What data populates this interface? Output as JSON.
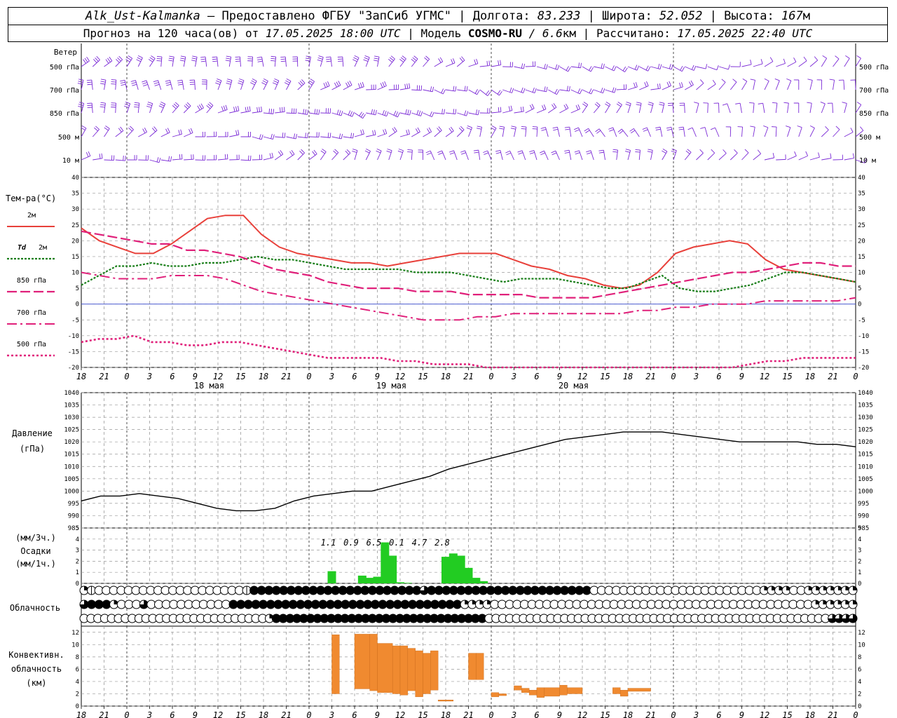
{
  "header": {
    "station": "Alk_Ust-Kalmanka",
    "provider": "– Предоставлено ФГБУ \"ЗапСиб УГМС\"",
    "lon_label": "| Долгота:",
    "lon_value": "83.233",
    "lat_label": "| Широта:",
    "lat_value": "52.052",
    "alt_label": "| Высота:",
    "alt_value": "167",
    "alt_unit": "м",
    "fc_label": "Прогноз на 120 часа(ов) от",
    "fc_date": "17.05.2025 18:00 UTC",
    "model_label": "| Модель",
    "model_name": "COSMO-RU",
    "model_res": "/ 6.6",
    "model_res_unit": "км",
    "calc_label": "| Рассчитано:",
    "calc_date": "17.05.2025 22:40 UTC"
  },
  "colors": {
    "wind": "#7b2ad6",
    "t2m": "#e8403a",
    "td2m": "#1a7f1a",
    "p850": "#e0207a",
    "p700": "#e0207a",
    "p500": "#e0207a",
    "zero": "#3344cc",
    "pressure": "#000000",
    "precip": "#22cc22",
    "conv": "#f08a30",
    "grid": "#999999"
  },
  "panels": {
    "wind": {
      "title": "Ветер",
      "levels": [
        "500 гПа",
        "700 гПа",
        "850 гПа",
        "500 м",
        "10 м"
      ]
    },
    "temp": {
      "title": "Тем-ра(°C)",
      "legend": [
        {
          "key": "t2m",
          "label": "2м"
        },
        {
          "key": "td2m",
          "label": "Td",
          "label2": "2м"
        },
        {
          "key": "p850",
          "label": "850 гПа"
        },
        {
          "key": "p700",
          "label": "700 гПа"
        },
        {
          "key": "p500",
          "label": "500 гПа"
        }
      ]
    },
    "pressure": {
      "title": "Давление",
      "unit": "(гПа)"
    },
    "precip": {
      "unit_top": "(мм/3ч.)",
      "title": "Осадки",
      "unit_bottom": "(мм/1ч.)"
    },
    "cloud": {
      "title": "Облачность"
    },
    "conv": {
      "title1": "Конвективн.",
      "title2": "облачность",
      "unit": "(км)"
    }
  },
  "time_axis": {
    "hour_ticks": [
      "18",
      "21",
      "0",
      "3",
      "6",
      "9",
      "12",
      "15",
      "18",
      "21",
      "0",
      "3",
      "6",
      "9",
      "12",
      "15",
      "18",
      "21",
      "0",
      "3",
      "6",
      "9",
      "12",
      "15",
      "18",
      "21",
      "0",
      "3",
      "6",
      "9",
      "12",
      "15",
      "18",
      "21",
      "0"
    ],
    "day_labels": [
      "18 мая",
      "19 мая",
      "20 мая"
    ]
  },
  "chart_data": {
    "type": "line",
    "x_hours": [
      0,
      3,
      6,
      9,
      12,
      15,
      18,
      21,
      24,
      27,
      30,
      33,
      36,
      39,
      42,
      45,
      48,
      51,
      54,
      57,
      60,
      63,
      66,
      69,
      72,
      75,
      78,
      81,
      84,
      87,
      90,
      93,
      96,
      99,
      102
    ],
    "temperature": {
      "ylim": [
        -20,
        40
      ],
      "yticks": [
        -20,
        -15,
        -10,
        -5,
        0,
        5,
        10,
        15,
        20,
        25,
        30,
        35,
        40
      ],
      "series": [
        {
          "key": "t2m",
          "name": "2м",
          "values": [
            24,
            20,
            18,
            16,
            16,
            19,
            23,
            27,
            28,
            28,
            22,
            18,
            16,
            15,
            14,
            13,
            13,
            12,
            13,
            14,
            15,
            16,
            16,
            16,
            14,
            12,
            11,
            9,
            8,
            6,
            5,
            6,
            10,
            16,
            18,
            19,
            20,
            19,
            14,
            11,
            10,
            9,
            8,
            7
          ]
        },
        {
          "key": "td2m",
          "name": "Td 2м",
          "values": [
            6,
            9,
            12,
            12,
            13,
            12,
            12,
            13,
            13,
            14,
            15,
            14,
            14,
            13,
            12,
            11,
            11,
            11,
            11,
            10,
            10,
            10,
            9,
            8,
            7,
            8,
            8,
            8,
            7,
            6,
            5,
            5,
            7,
            9,
            5,
            4,
            4,
            5,
            6,
            8,
            10,
            10,
            9,
            8,
            7
          ]
        },
        {
          "key": "p850",
          "name": "850 гПа",
          "values": [
            23,
            22,
            21,
            20,
            19,
            19,
            17,
            17,
            16,
            15,
            13,
            11,
            10,
            9,
            7,
            6,
            5,
            5,
            5,
            4,
            4,
            4,
            3,
            3,
            3,
            3,
            2,
            2,
            2,
            2,
            3,
            4,
            5,
            6,
            7,
            8,
            9,
            10,
            10,
            11,
            12,
            13,
            13,
            12,
            12
          ]
        },
        {
          "key": "p700",
          "name": "700 гПа",
          "values": [
            10,
            9,
            8,
            8,
            8,
            9,
            9,
            9,
            8,
            6,
            4,
            3,
            2,
            1,
            0,
            -1,
            -2,
            -3,
            -4,
            -5,
            -5,
            -5,
            -4,
            -4,
            -3,
            -3,
            -3,
            -3,
            -3,
            -3,
            -3,
            -2,
            -2,
            -1,
            -1,
            0,
            0,
            0,
            1,
            1,
            1,
            1,
            1,
            2
          ]
        },
        {
          "key": "p500",
          "name": "500 гПа",
          "values": [
            -12,
            -11,
            -11,
            -10,
            -12,
            -12,
            -13,
            -13,
            -12,
            -12,
            -13,
            -14,
            -15,
            -16,
            -17,
            -17,
            -17,
            -17,
            -18,
            -18,
            -19,
            -19,
            -19,
            -20,
            -20,
            -20,
            -20,
            -20,
            -20,
            -20,
            -20,
            -20,
            -20,
            -20,
            -20,
            -20,
            -20,
            -20,
            -19,
            -18,
            -18,
            -17,
            -17,
            -17,
            -17
          ]
        }
      ]
    },
    "pressure": {
      "ylim": [
        985,
        1040
      ],
      "yticks": [
        985,
        990,
        995,
        1000,
        1005,
        1010,
        1015,
        1020,
        1025,
        1030,
        1035,
        1040
      ],
      "values": [
        996,
        998,
        998,
        999,
        998,
        997,
        995,
        993,
        992,
        992,
        993,
        996,
        998,
        999,
        1000,
        1000,
        1002,
        1004,
        1006,
        1009,
        1011,
        1013,
        1015,
        1017,
        1019,
        1021,
        1022,
        1023,
        1024,
        1024,
        1024,
        1023,
        1022,
        1021,
        1020,
        1020,
        1020,
        1020,
        1019,
        1019,
        1018
      ]
    },
    "precipitation": {
      "ylim": [
        0,
        5
      ],
      "yticks": [
        0,
        1,
        2,
        3,
        4,
        5
      ],
      "hourly_start_hour": 24,
      "hourly_values": [
        0,
        0,
        0,
        0,
        0,
        0,
        0,
        0,
        0,
        1.1,
        0,
        0,
        0,
        0.7,
        0.5,
        0.6,
        3.7,
        2.5,
        0.1,
        0.05,
        0,
        0,
        0,
        0,
        2.4,
        2.7,
        2.5,
        1.4,
        0.5,
        0.2
      ],
      "totals": [
        "1.1",
        "0.9",
        "6.5",
        "0.1",
        "4.7",
        "2.8"
      ],
      "total_hours": [
        33,
        36,
        39,
        42,
        45,
        48
      ]
    },
    "cloud_cover": {
      "rows": [
        [
          2,
          1,
          0,
          0,
          0,
          0,
          0,
          0,
          0,
          0,
          0,
          0,
          0,
          0,
          0,
          0,
          0,
          0,
          0,
          0,
          0,
          0,
          1,
          4,
          4,
          4,
          4,
          4,
          4,
          4,
          4,
          4,
          4,
          4,
          4,
          4,
          4,
          4,
          4,
          4,
          4,
          4,
          4,
          4,
          4,
          4,
          3,
          4,
          4,
          4,
          4,
          4,
          4,
          4,
          4,
          4,
          4,
          4,
          4,
          4,
          4,
          4,
          4,
          4,
          4,
          4,
          4,
          4,
          4,
          0,
          0,
          0,
          0,
          0,
          0,
          0,
          0,
          0,
          0,
          0,
          0,
          0,
          0,
          0,
          0,
          0,
          0,
          0,
          0,
          0,
          0,
          0,
          2,
          2,
          2,
          2,
          0,
          0,
          2,
          2,
          2,
          2,
          2,
          2,
          2
        ],
        [
          3,
          4,
          4,
          4,
          2,
          0,
          0,
          0,
          3,
          0,
          0,
          0,
          0,
          0,
          0,
          0,
          0,
          0,
          0,
          0,
          4,
          4,
          4,
          4,
          4,
          4,
          4,
          4,
          4,
          4,
          4,
          4,
          4,
          4,
          4,
          4,
          4,
          4,
          4,
          4,
          4,
          4,
          4,
          4,
          4,
          4,
          4,
          4,
          4,
          4,
          4,
          2,
          2,
          2,
          2,
          0,
          0,
          0,
          0,
          0,
          0,
          0,
          0,
          0,
          0,
          0,
          0,
          0,
          0,
          0,
          0,
          0,
          0,
          0,
          0,
          0,
          0,
          0,
          0,
          0,
          0,
          0,
          0,
          0,
          0,
          0,
          0,
          0,
          0,
          0,
          0,
          0,
          0,
          0,
          0,
          0,
          0,
          0,
          2,
          2,
          2,
          2,
          2,
          2
        ],
        [
          0,
          0,
          0,
          0,
          0,
          0,
          0,
          0,
          0,
          0,
          0,
          0,
          0,
          0,
          0,
          0,
          0,
          0,
          0,
          0,
          0,
          0,
          0,
          0,
          0,
          0,
          0,
          2,
          4,
          4,
          4,
          4,
          4,
          4,
          4,
          4,
          4,
          4,
          4,
          4,
          4,
          4,
          4,
          4,
          4,
          4,
          4,
          4,
          4,
          4,
          4,
          4,
          4,
          4,
          4,
          4,
          4,
          4,
          4,
          0,
          0,
          0,
          0,
          0,
          0,
          0,
          0,
          0,
          0,
          0,
          0,
          0,
          0,
          0,
          0,
          0,
          0,
          0,
          0,
          0,
          0,
          0,
          0,
          0,
          0,
          0,
          0,
          0,
          0,
          0,
          0,
          0,
          0,
          0,
          0,
          0,
          0,
          0,
          0,
          0,
          0,
          0,
          0,
          0,
          0,
          0,
          0,
          0,
          0,
          3,
          3,
          3,
          3
        ]
      ]
    },
    "convective_cloud": {
      "ylim": [
        0,
        13
      ],
      "yticks": [
        0,
        2,
        4,
        6,
        8,
        10,
        12
      ],
      "bars": [
        {
          "h0": 33,
          "h1": 34,
          "base": 2,
          "top": 11.6
        },
        {
          "h0": 36,
          "h1": 38,
          "base": 2.8,
          "top": 11.7
        },
        {
          "h0": 38,
          "h1": 39,
          "base": 2.5,
          "top": 11.7
        },
        {
          "h0": 39,
          "h1": 41,
          "base": 2.2,
          "top": 10.2
        },
        {
          "h0": 41,
          "h1": 42,
          "base": 2.0,
          "top": 9.8
        },
        {
          "h0": 42,
          "h1": 43,
          "base": 1.8,
          "top": 9.8
        },
        {
          "h0": 43,
          "h1": 44,
          "base": 2.5,
          "top": 9.4
        },
        {
          "h0": 44,
          "h1": 45,
          "base": 1.5,
          "top": 9.0
        },
        {
          "h0": 45,
          "h1": 46,
          "base": 2.0,
          "top": 8.6
        },
        {
          "h0": 46,
          "h1": 47,
          "base": 2.6,
          "top": 9.0
        },
        {
          "h0": 47,
          "h1": 49,
          "base": 0.8,
          "top": 1.0
        },
        {
          "h0": 51,
          "h1": 52,
          "base": 4.3,
          "top": 8.6
        },
        {
          "h0": 52,
          "h1": 53,
          "base": 4.3,
          "top": 8.6
        },
        {
          "h0": 54,
          "h1": 55,
          "base": 1.5,
          "top": 2.2
        },
        {
          "h0": 55,
          "h1": 56,
          "base": 1.7,
          "top": 2.0
        },
        {
          "h0": 57,
          "h1": 58,
          "base": 2.6,
          "top": 3.3
        },
        {
          "h0": 58,
          "h1": 59,
          "base": 2.2,
          "top": 2.9
        },
        {
          "h0": 59,
          "h1": 60,
          "base": 1.8,
          "top": 2.6
        },
        {
          "h0": 60,
          "h1": 61,
          "base": 1.4,
          "top": 3.0
        },
        {
          "h0": 61,
          "h1": 63,
          "base": 1.6,
          "top": 3.0
        },
        {
          "h0": 63,
          "h1": 64,
          "base": 1.8,
          "top": 3.4
        },
        {
          "h0": 64,
          "h1": 66,
          "base": 2.0,
          "top": 3.0
        },
        {
          "h0": 70,
          "h1": 71,
          "base": 2.0,
          "top": 3.0
        },
        {
          "h0": 71,
          "h1": 72,
          "base": 1.6,
          "top": 2.6
        },
        {
          "h0": 72,
          "h1": 75,
          "base": 2.4,
          "top": 2.9
        }
      ]
    }
  }
}
